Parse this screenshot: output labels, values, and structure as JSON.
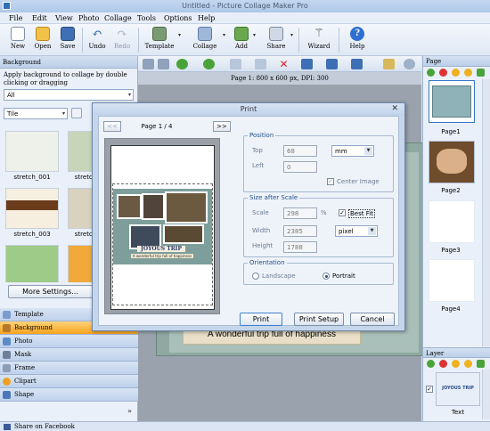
{
  "window": {
    "title": "Untitled - Picture Collage Maker Pro"
  },
  "menu": [
    "File",
    "Edit",
    "View",
    "Photo",
    "Collage",
    "Tools",
    "Options",
    "Help"
  ],
  "toolbar": {
    "new": "New",
    "open": "Open",
    "save": "Save",
    "undo": "Undo",
    "redo": "Redo",
    "template": "Template",
    "collage": "Collage",
    "add": "Add",
    "share": "Share",
    "wizard": "Wizard",
    "help": "Help"
  },
  "left_panel": {
    "title": "Background",
    "hint": "Apply background to collage by double clicking or dragging",
    "filter_value": "All",
    "mode_value": "Tile",
    "thumbs": [
      "stretch_001",
      "stretch",
      "stretch_003",
      "stretch"
    ],
    "more_button": "More Settings..."
  },
  "categories": [
    "Template",
    "Background",
    "Photo",
    "Mask",
    "Frame",
    "Clipart",
    "Shape"
  ],
  "status": {
    "share": "Share on Facebook"
  },
  "canvas": {
    "info": "Page 1: 800 x 600 px, DPI: 300",
    "caption": "A wonderful trip full of happiness"
  },
  "right_panel": {
    "title": "Page",
    "pages": [
      "Page1",
      "Page2",
      "Page3",
      "Page4"
    ],
    "layer_title": "Layer",
    "layer_item": "Text",
    "layer_thumb_text": "JOYOUS TRIP"
  },
  "dialog": {
    "title": "Print",
    "prev": "<<",
    "next": ">>",
    "page_indicator": "Page 1 / 4",
    "preview_title": "JOYOUS TRIP",
    "preview_sub": "A wonderful trip full of happiness",
    "position": {
      "legend": "Position",
      "top_label": "Top",
      "top_value": "68",
      "left_label": "Left",
      "left_value": "0",
      "unit": "mm",
      "center_image": "Center Image"
    },
    "size": {
      "legend": "Size after Scale",
      "scale_label": "Scale",
      "scale_value": "298",
      "scale_unit": "%",
      "best_fit": "Best Fit",
      "width_label": "Width",
      "width_value": "2385",
      "height_label": "Height",
      "height_value": "1788",
      "unit": "pixel"
    },
    "orientation": {
      "legend": "Orientation",
      "landscape": "Landscape",
      "portrait": "Portrait"
    },
    "buttons": {
      "print": "Print",
      "print_setup": "Print Setup",
      "cancel": "Cancel"
    }
  }
}
